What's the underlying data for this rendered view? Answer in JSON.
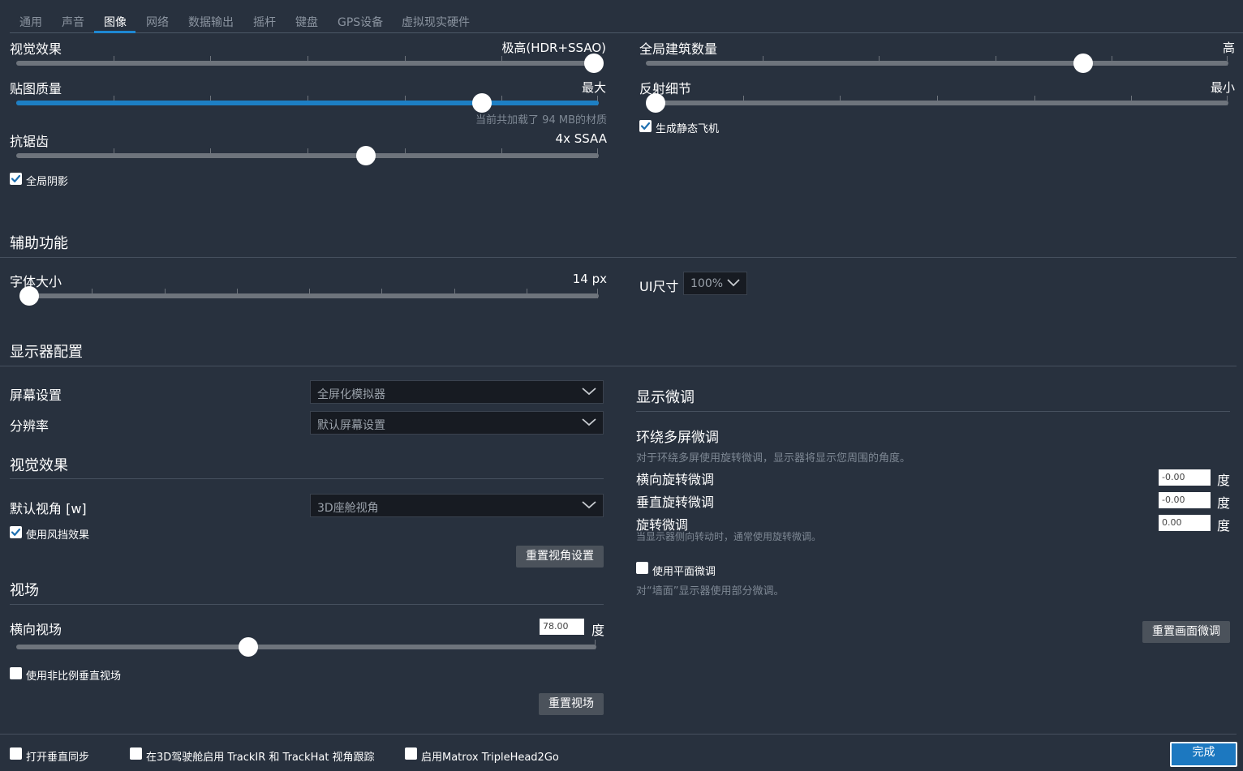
{
  "tabs": [
    {
      "label": "通用",
      "active": false
    },
    {
      "label": "声音",
      "active": false
    },
    {
      "label": "图像",
      "active": true
    },
    {
      "label": "网络",
      "active": false
    },
    {
      "label": "数据输出",
      "active": false
    },
    {
      "label": "摇杆",
      "active": false
    },
    {
      "label": "键盘",
      "active": false
    },
    {
      "label": "GPS设备",
      "active": false
    },
    {
      "label": "虚拟现实硬件",
      "active": false
    }
  ],
  "graphics": {
    "visual_effects": {
      "label": "视觉效果",
      "value_text": "极高(HDR+SSAO)",
      "level": 1.0,
      "ticks": 5
    },
    "texture_quality": {
      "label": "贴图质量",
      "value_text": "最大",
      "level": 0.8,
      "ticks": 5,
      "hint": "当前共加载了 94 MB的材质"
    },
    "antialiasing": {
      "label": "抗锯齿",
      "value_text": "4x SSAA",
      "level": 0.6,
      "ticks": 5
    },
    "global_shadows": {
      "label": "全局阴影",
      "checked": true
    },
    "world_objects": {
      "label": "全局建筑数量",
      "value_text": "高",
      "level": 0.75,
      "ticks": 4
    },
    "reflection_detail": {
      "label": "反射细节",
      "value_text": "最小",
      "level": 0.0,
      "ticks": 5
    },
    "static_aircraft": {
      "label": "生成静态飞机",
      "checked": true
    }
  },
  "accessibility": {
    "title": "辅助功能",
    "font_size": {
      "label": "字体大小",
      "value_text": "14 px",
      "level": 0.0,
      "ticks": 7
    },
    "ui_size": {
      "label": "UI尺寸",
      "value": "100%"
    }
  },
  "monitor": {
    "title": "显示器配置",
    "screen_settings": {
      "label": "屏幕设置",
      "value": "全屏化模拟器"
    },
    "resolution": {
      "label": "分辨率",
      "value": "默认屏幕设置"
    }
  },
  "visuals": {
    "title": "视觉效果",
    "default_view": {
      "label": "默认视角 [w]",
      "value": "3D座舱视角"
    },
    "windshield": {
      "label": "使用风挡效果",
      "checked": true
    },
    "reset_view_button": "重置视角设置"
  },
  "fov": {
    "title": "视场",
    "horizontal": {
      "label": "横向视场",
      "value": "78.00",
      "unit": "度",
      "level": 0.4
    },
    "non_proportional": {
      "label": "使用非比例垂直视场",
      "checked": false
    },
    "reset_button": "重置视场"
  },
  "fine_tune": {
    "title": "显示微调",
    "wrap_title": "环绕多屏微调",
    "wrap_desc": "对于环绕多屏使用旋转微调，显示器将显示您周围的角度。",
    "lateral": {
      "label": "横向旋转微调",
      "value": "-0.00",
      "unit": "度"
    },
    "vertical": {
      "label": "垂直旋转微调",
      "value": "-0.00",
      "unit": "度"
    },
    "roll": {
      "label": "旋转微调",
      "value": "0.00",
      "unit": "度",
      "hint": "当显示器侧向转动时，通常使用旋转微调。"
    },
    "flat": {
      "label": "使用平面微调",
      "checked": false,
      "hint": "对“墙面”显示器使用部分微调。"
    },
    "reset_button": "重置画面微调"
  },
  "footer": {
    "vsync": {
      "label": "打开垂直同步",
      "checked": false
    },
    "trackir": {
      "label": "在3D驾驶舱启用 TrackIR 和 TrackHat 视角跟踪",
      "checked": false
    },
    "matrox": {
      "label": "启用Matrox TripleHead2Go",
      "checked": false
    },
    "done_button": "完成"
  },
  "colors": {
    "accent": "#1d7fc4",
    "background": "#28313e",
    "track": "#6e747c"
  }
}
